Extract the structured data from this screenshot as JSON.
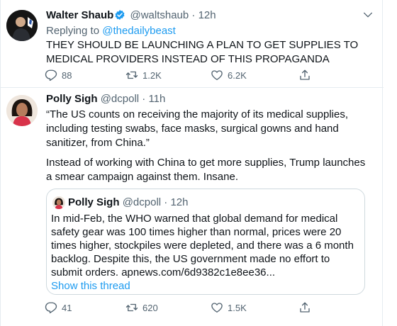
{
  "tweets": [
    {
      "author_name": "Walter Shaub",
      "author_handle": "@waltshaub",
      "separator": "·",
      "time": "12h",
      "replying_prefix": "Replying to",
      "replying_to": "@thedailybeast",
      "text": "THEY SHOULD BE LAUNCHING A PLAN TO GET SUPPLIES TO MEDICAL PROVIDERS INSTEAD OF THIS PROPAGANDA",
      "reply_count": "88",
      "retweet_count": "1.2K",
      "like_count": "6.2K"
    },
    {
      "author_name": "Polly Sigh",
      "author_handle": "@dcpoll",
      "separator": "·",
      "time": "11h",
      "text_paragraph_1": "“The US counts on receiving the majority of its medical supplies, including testing swabs, face masks, surgical gowns and hand sanitizer, from China.”",
      "text_paragraph_2": "Instead of working with China to get more supplies, Trump launches a smear campaign against them. Insane.",
      "quoted": {
        "author_name": "Polly Sigh",
        "author_handle": "@dcpoll",
        "separator": "·",
        "time": "12h",
        "text": "In mid-Feb, the WHO warned that global demand for medical safety gear was 100 times higher than normal, prices were 20 times higher, stockpiles were depleted, and there was a 6 month backlog. Despite this, the US government made no effort to submit orders. apnews.com/6d9382c1e8ee36...",
        "show_thread": "Show this thread"
      },
      "reply_count": "41",
      "retweet_count": "620",
      "like_count": "1.5K"
    }
  ],
  "colors": {
    "accent": "#1d9bf0",
    "secondary_text": "#536471",
    "border": "#e6ecf0"
  },
  "icons": [
    "verified-badge-icon",
    "more-icon",
    "reply-icon",
    "retweet-icon",
    "like-icon",
    "share-icon"
  ]
}
